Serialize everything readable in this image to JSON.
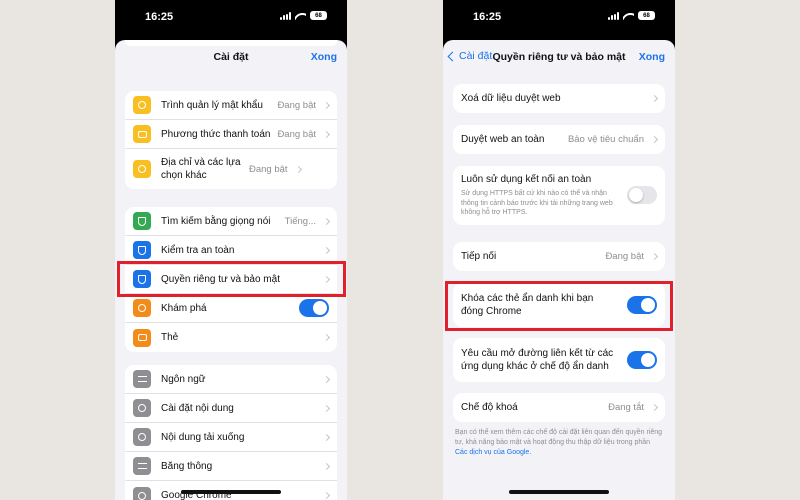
{
  "left": {
    "status": {
      "time": "16:25",
      "battery": "68"
    },
    "nav": {
      "title": "Cài đặt",
      "done": "Xong"
    },
    "group1": [
      {
        "label": "Trình quản lý mật khẩu",
        "value": "Đang bật",
        "icon": "key-icon",
        "color": "#f9bf22"
      },
      {
        "label": "Phương thức thanh toán",
        "value": "Đang bật",
        "icon": "card-icon",
        "color": "#f9bf22"
      },
      {
        "label": "Địa chỉ và các lựa chọn khác",
        "value": "Đang bật",
        "icon": "location-pin-icon",
        "color": "#f9bf22"
      }
    ],
    "group2": [
      {
        "label": "Tìm kiếm bằng giọng nói",
        "value": "Tiếng...",
        "icon": "microphone-icon",
        "color": "#34a853"
      },
      {
        "label": "Kiểm tra an toàn",
        "value": "",
        "icon": "shield-check-icon",
        "color": "#1a73e8"
      },
      {
        "label": "Quyền riêng tư và bảo mật",
        "value": "",
        "icon": "shield-lock-icon",
        "color": "#1a73e8"
      },
      {
        "label": "Khám phá",
        "value": "",
        "icon": "flame-icon",
        "color": "#f28b1a",
        "toggle": true
      },
      {
        "label": "Thẻ",
        "value": "",
        "icon": "tabs-icon",
        "color": "#f28b1a"
      }
    ],
    "group3": [
      {
        "label": "Ngôn ngữ",
        "icon": "translate-icon",
        "color": "#8e8e93"
      },
      {
        "label": "Cài đặt nội dung",
        "icon": "gear-icon",
        "color": "#8e8e93"
      },
      {
        "label": "Nội dung tải xuống",
        "icon": "download-icon",
        "color": "#8e8e93"
      },
      {
        "label": "Băng thông",
        "icon": "bandwidth-icon",
        "color": "#8e8e93"
      },
      {
        "label": "Google Chrome",
        "icon": "info-icon",
        "color": "#8e8e93"
      }
    ]
  },
  "right": {
    "status": {
      "time": "16:25",
      "battery": "68"
    },
    "nav": {
      "back": "Cài đặt",
      "title": "Quyền riêng tư và bảo mật",
      "done": "Xong"
    },
    "clear_data": "Xoá dữ liệu duyệt web",
    "safe_browsing": {
      "label": "Duyệt web an toàn",
      "value": "Bảo vệ tiêu chuẩn"
    },
    "https": {
      "label": "Luôn sử dụng kết nối an toàn",
      "desc": "Sử dụng HTTPS bất cứ khi nào có thể và nhận thông tin cảnh báo trước khi tải những trang web không hỗ trợ HTTPS."
    },
    "handoff": {
      "label": "Tiếp nối",
      "value": "Đang bật"
    },
    "lock_incognito": "Khóa các thẻ ẩn danh khi bạn đóng Chrome",
    "open_links_incognito": "Yêu cầu mở đường liên kết từ các ứng dụng khác ở chế độ ẩn danh",
    "lockdown": {
      "label": "Chế độ khoá",
      "value": "Đang tắt"
    },
    "footer": "Bạn có thể xem thêm các chế độ cài đặt liên quan đến quyền riêng tư, khả năng bảo mật và hoạt động thu thập dữ liệu trong phần",
    "footer_link": "Các dịch vụ của Google."
  },
  "colors": {
    "accent": "#1a73e8",
    "highlight": "#e0202a"
  }
}
